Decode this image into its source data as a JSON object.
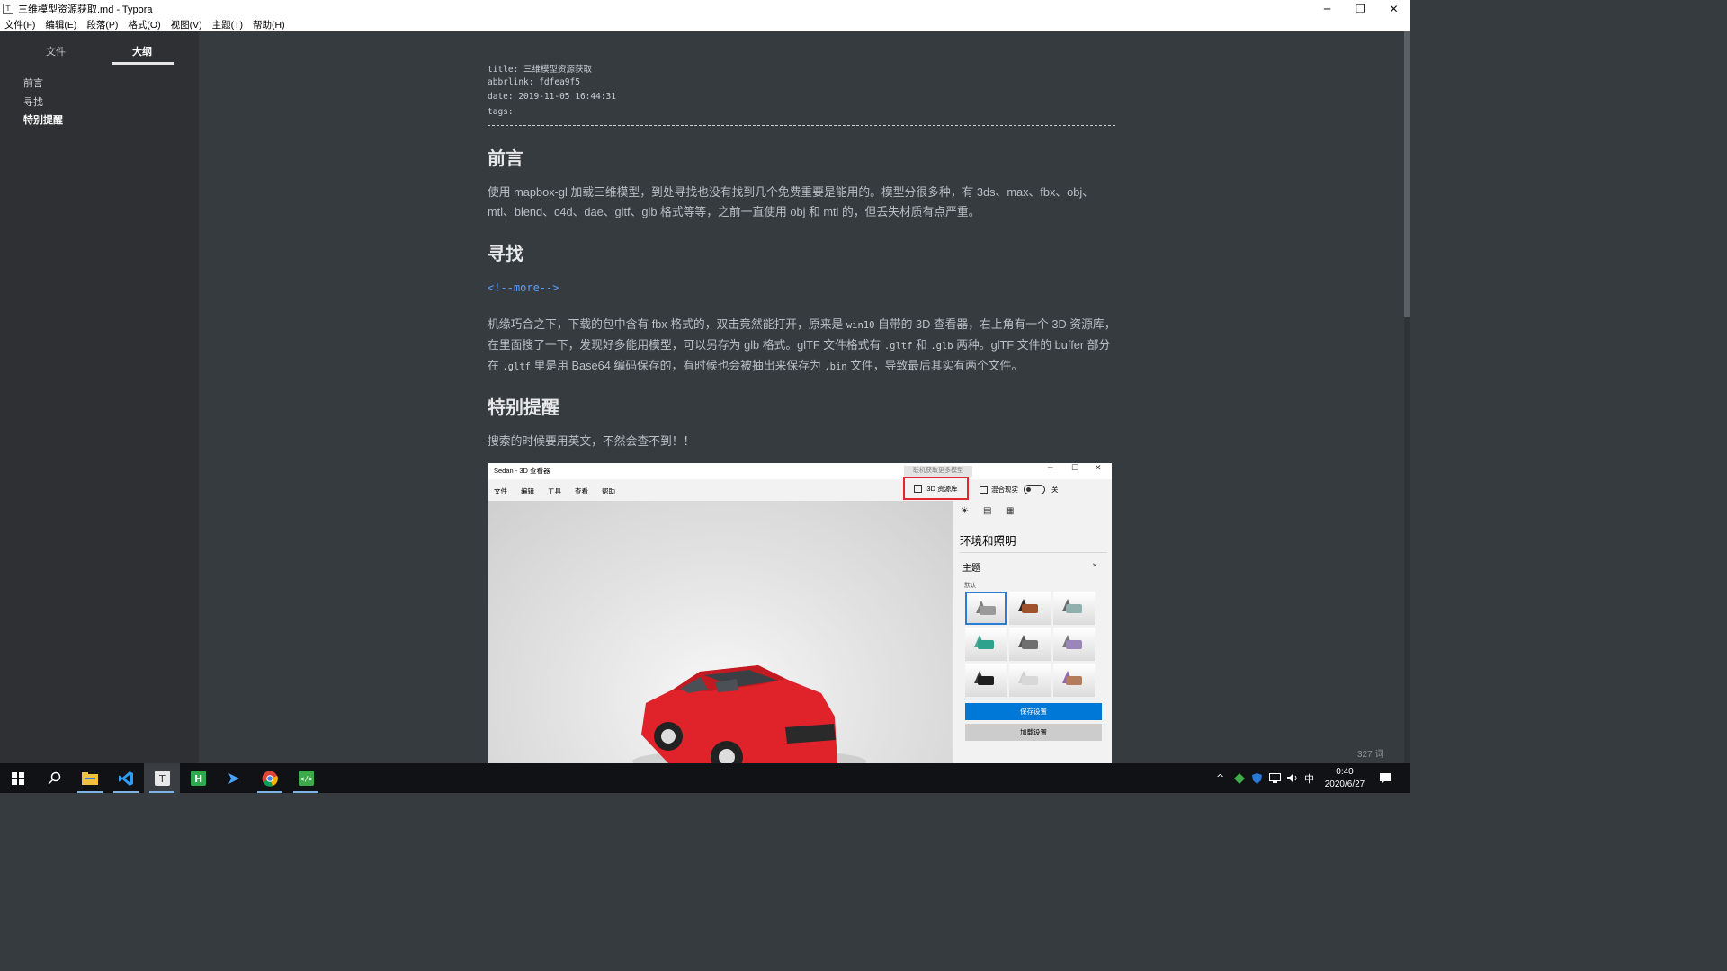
{
  "window": {
    "app_icon": "T",
    "title": "三维模型资源获取.md - Typora",
    "buttons": {
      "minimize": "─",
      "restore": "❐",
      "close": "✕"
    }
  },
  "menubar": [
    "文件(F)",
    "编辑(E)",
    "段落(P)",
    "格式(O)",
    "视图(V)",
    "主题(T)",
    "帮助(H)"
  ],
  "sidebar": {
    "tabs": {
      "files": "文件",
      "outline": "大纲"
    },
    "outline": [
      "前言",
      "寻找",
      "特别提醒"
    ],
    "bottom": {
      "back": "<",
      "source": "</>"
    }
  },
  "front_matter": {
    "title": "title: 三维模型资源获取",
    "abbrlink": "abbrlink: fdfea9f5",
    "date": "date: 2019-11-05 16:44:31",
    "tags": "tags:"
  },
  "doc": {
    "h_intro": "前言",
    "p_intro": "使用 mapbox-gl 加载三维模型，到处寻找也没有找到几个免费重要是能用的。模型分很多种，有 3ds、max、fbx、obj、mtl、blend、c4d、dae、gltf、glb 格式等等，之前一直使用 obj 和 mtl 的，但丢失材质有点严重。",
    "h_find": "寻找",
    "more_comment": "<!--more-->",
    "p_find": {
      "t1": "机缘巧合之下，下载的包中含有 fbx 格式的，双击竟然能打开，原来是 ",
      "c1": "win10",
      "t2": " 自带的 3D 查看器，右上角有一个 3D 资源库，在里面搜了一下，发现好多能用模型，可以另存为 glb 格式。glTF 文件格式有 ",
      "c2": ".gltf",
      "t3": " 和 ",
      "c3": ".glb",
      "t4": " 两种。glTF 文件的 buffer 部分在 ",
      "c4": ".gltf",
      "t5": " 里是用 Base64 编码保存的，有时候也会被抽出来保存为 ",
      "c5": ".bin",
      "t6": " 文件，导致最后其实有两个文件。"
    },
    "h_note": "特别提醒",
    "p_note": "搜索的时候要用英文，不然会查不到！！"
  },
  "viewer": {
    "title": "Sedan - 3D 查看器",
    "tooltip": "联机获取更多模型",
    "menu": [
      "文件",
      "编辑",
      "工具",
      "查看",
      "帮助"
    ],
    "library_button": "3D 资源库",
    "mixed_reality": "混合现实",
    "toggle_state": "关",
    "panel_title": "环境和照明",
    "theme_label": "主题",
    "default_label": "默认",
    "save_button": "保存设置",
    "load_button": "加载设置",
    "theme_tiles": [
      {
        "base": "#9a9a9a",
        "accent": "#7d7d7d"
      },
      {
        "base": "#a0522d",
        "accent": "#2a2a2a"
      },
      {
        "base": "#8fb0ae",
        "accent": "#666"
      },
      {
        "base": "#2ea28c",
        "accent": "#4aa896"
      },
      {
        "base": "#6f6f6f",
        "accent": "#555"
      },
      {
        "base": "#9a86b8",
        "accent": "#777"
      },
      {
        "base": "#1e1e1e",
        "accent": "#3a3a3a"
      },
      {
        "base": "#d8d8d8",
        "accent": "#cfcfcf"
      },
      {
        "base": "#b37c5c",
        "accent": "#8a6aa8"
      }
    ],
    "car_color": "#e0222a"
  },
  "status": {
    "word_count": "327 词"
  },
  "taskbar": {
    "apps": [
      "windows-start",
      "search",
      "file-explorer",
      "vscode",
      "typora",
      "hbuilder",
      "terminal",
      "chrome",
      "code-editor"
    ],
    "ime": "中",
    "time": "0:40",
    "date": "2020/6/27"
  }
}
